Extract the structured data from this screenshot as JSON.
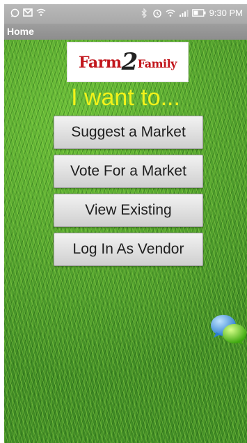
{
  "status_bar": {
    "time": "9:30 PM",
    "left_icons": [
      "whatsapp-icon",
      "gmail-icon",
      "wifi-icon"
    ],
    "right_icons": [
      "bluetooth-icon",
      "alarm-icon",
      "wifi-icon",
      "signal-icon",
      "battery-icon"
    ]
  },
  "app_bar": {
    "title": "Home"
  },
  "logo": {
    "part1": "Farm",
    "part2": "2",
    "part3": "Family"
  },
  "main": {
    "heading": "I want to...",
    "buttons": [
      {
        "label": "Suggest a Market"
      },
      {
        "label": "Vote For a Market"
      },
      {
        "label": "View Existing"
      },
      {
        "label": "Log In As Vendor"
      }
    ]
  },
  "colors": {
    "heading": "#f2f21a",
    "status_bar": "#b0b0b0",
    "title_bar": "#969696",
    "logo_red": "#c2161c"
  },
  "floating_widget": "chat-bubbles-icon"
}
